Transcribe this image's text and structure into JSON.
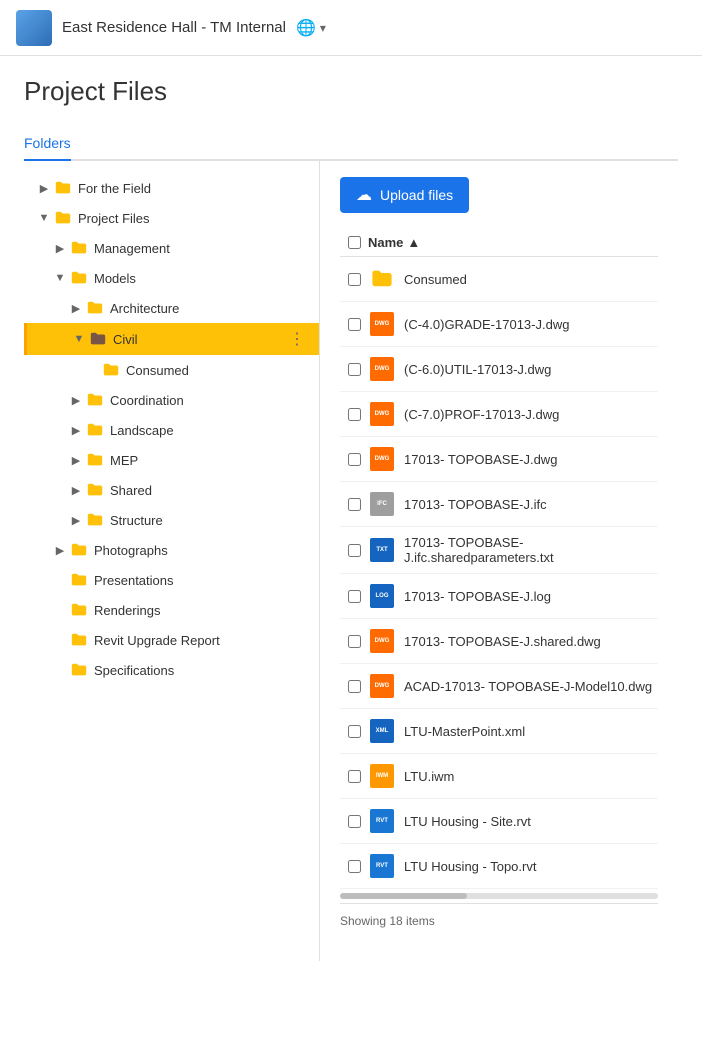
{
  "header": {
    "project_name": "East Residence Hall - TM Internal",
    "logo_alt": "Project logo"
  },
  "page": {
    "title": "Project Files",
    "tabs": [
      {
        "id": "folders",
        "label": "Folders",
        "active": true
      }
    ]
  },
  "sidebar": {
    "items": [
      {
        "id": "for-the-field",
        "label": "For the Field",
        "indent": 0,
        "chevron": "right",
        "has_folder_icon": true,
        "active": false
      },
      {
        "id": "project-files",
        "label": "Project Files",
        "indent": 0,
        "chevron": "down",
        "has_folder_icon": true,
        "active": false
      },
      {
        "id": "management",
        "label": "Management",
        "indent": 1,
        "chevron": "right",
        "has_folder_icon": true,
        "active": false
      },
      {
        "id": "models",
        "label": "Models",
        "indent": 1,
        "chevron": "down",
        "has_folder_icon": true,
        "active": false
      },
      {
        "id": "architecture",
        "label": "Architecture",
        "indent": 2,
        "chevron": "right",
        "has_folder_icon": true,
        "active": false
      },
      {
        "id": "civil",
        "label": "Civil",
        "indent": 2,
        "chevron": "down",
        "has_folder_icon": true,
        "active": true
      },
      {
        "id": "consumed",
        "label": "Consumed",
        "indent": 3,
        "chevron": "empty",
        "has_folder_icon": true,
        "active": false
      },
      {
        "id": "coordination",
        "label": "Coordination",
        "indent": 2,
        "chevron": "right",
        "has_folder_icon": true,
        "active": false
      },
      {
        "id": "landscape",
        "label": "Landscape",
        "indent": 2,
        "chevron": "right",
        "has_folder_icon": true,
        "active": false
      },
      {
        "id": "mep",
        "label": "MEP",
        "indent": 2,
        "chevron": "right",
        "has_folder_icon": true,
        "active": false
      },
      {
        "id": "shared",
        "label": "Shared",
        "indent": 2,
        "chevron": "right",
        "has_folder_icon": true,
        "active": false
      },
      {
        "id": "structure",
        "label": "Structure",
        "indent": 2,
        "chevron": "right",
        "has_folder_icon": true,
        "active": false
      },
      {
        "id": "photographs",
        "label": "Photographs",
        "indent": 1,
        "chevron": "right",
        "has_folder_icon": true,
        "active": false
      },
      {
        "id": "presentations",
        "label": "Presentations",
        "indent": 1,
        "chevron": "empty",
        "has_folder_icon": true,
        "active": false
      },
      {
        "id": "renderings",
        "label": "Renderings",
        "indent": 1,
        "chevron": "empty",
        "has_folder_icon": true,
        "active": false
      },
      {
        "id": "revit-upgrade-report",
        "label": "Revit Upgrade Report",
        "indent": 1,
        "chevron": "empty",
        "has_folder_icon": true,
        "active": false
      },
      {
        "id": "specifications",
        "label": "Specifications",
        "indent": 1,
        "chevron": "empty",
        "has_folder_icon": true,
        "active": false
      }
    ]
  },
  "right_panel": {
    "upload_button_label": "Upload files",
    "column_name": "Name",
    "files": [
      {
        "id": "consumed-folder",
        "name": "Consumed",
        "type": "folder",
        "icon_type": "folder"
      },
      {
        "id": "file1",
        "name": "(C-4.0)GRADE-17013-J.dwg",
        "type": "file",
        "icon_type": "dwg"
      },
      {
        "id": "file2",
        "name": "(C-6.0)UTIL-17013-J.dwg",
        "type": "file",
        "icon_type": "dwg"
      },
      {
        "id": "file3",
        "name": "(C-7.0)PROF-17013-J.dwg",
        "type": "file",
        "icon_type": "dwg"
      },
      {
        "id": "file4",
        "name": "17013- TOPOBASE-J.dwg",
        "type": "file",
        "icon_type": "dwg"
      },
      {
        "id": "file5",
        "name": "17013- TOPOBASE-J.ifc",
        "type": "file",
        "icon_type": "ifc"
      },
      {
        "id": "file6",
        "name": "17013- TOPOBASE-J.ifc.sharedparameters.txt",
        "type": "file",
        "icon_type": "txt"
      },
      {
        "id": "file7",
        "name": "17013- TOPOBASE-J.log",
        "type": "file",
        "icon_type": "log"
      },
      {
        "id": "file8",
        "name": "17013- TOPOBASE-J.shared.dwg",
        "type": "file",
        "icon_type": "dwg"
      },
      {
        "id": "file9",
        "name": "ACAD-17013- TOPOBASE-J-Model10.dwg",
        "type": "file",
        "icon_type": "dwg"
      },
      {
        "id": "file10",
        "name": "LTU-MasterPoint.xml",
        "type": "file",
        "icon_type": "xml"
      },
      {
        "id": "file11",
        "name": "LTU.iwm",
        "type": "file",
        "icon_type": "iwm"
      },
      {
        "id": "file12",
        "name": "LTU Housing - Site.rvt",
        "type": "file",
        "icon_type": "rvt"
      },
      {
        "id": "file13",
        "name": "LTU Housing - Topo.rvt",
        "type": "file",
        "icon_type": "rvt"
      }
    ],
    "status": "Showing 18 items"
  },
  "icons": {
    "dwg": "DWG",
    "ifc": "IFC",
    "txt": "TXT",
    "log": "LOG",
    "xml": "XML",
    "iwm": "IWM",
    "rvt": "RVT"
  }
}
